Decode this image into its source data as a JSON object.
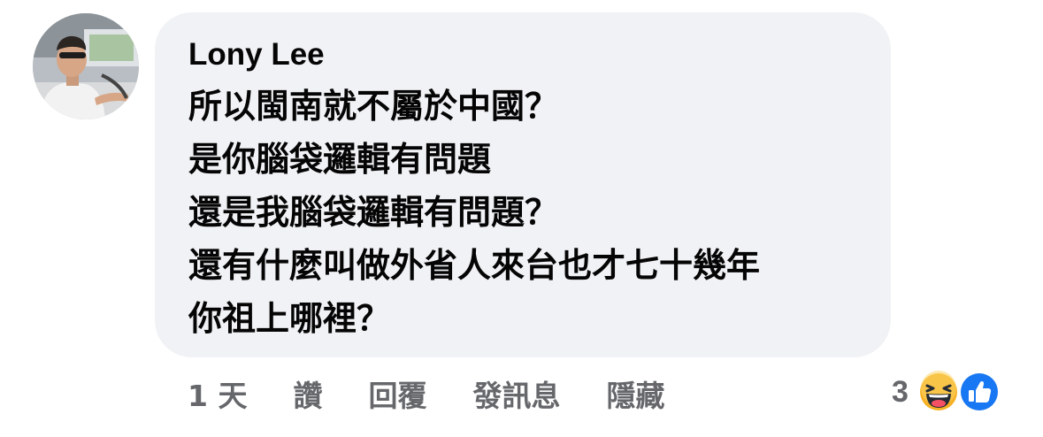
{
  "comment": {
    "author": "Lony Lee",
    "lines": [
      "所以閩南就不屬於中國？",
      "是你腦袋邏輯有問題",
      "還是我腦袋邏輯有問題？",
      "還有什麼叫做外省人來台也才七十幾年",
      "你祖上哪裡？"
    ]
  },
  "actions": {
    "time": "1 天",
    "like": "讚",
    "reply": "回覆",
    "message": "發訊息",
    "hide": "隱藏"
  },
  "reactions": {
    "count": "3",
    "icons": [
      "haha-icon",
      "like-icon"
    ]
  },
  "colors": {
    "bubble": "#f0f2f5",
    "text": "#050505",
    "secondary": "#65676b",
    "like_blue": "#1877f2",
    "haha_yellow": "#f7b125"
  }
}
